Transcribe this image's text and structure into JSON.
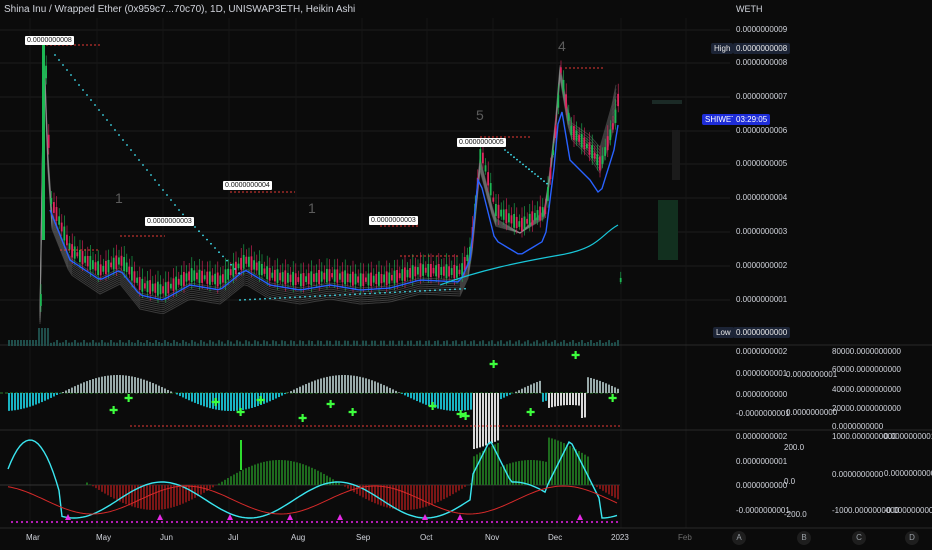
{
  "header": {
    "title": "Shina Inu / Wrapped Ether (0x959c7...70c70), 1D, UNISWAP3ETH, Heikin Ashi",
    "axis_unit": "WETH"
  },
  "price_axis": [
    "0.0000000009",
    "0.0000000008",
    "0.0000000007",
    "0.0000000006",
    "0.0000000005",
    "0.0000000004",
    "0.0000000003",
    "0.0000000002",
    "0.0000000001",
    "0.0000000000"
  ],
  "tags": {
    "high_label": "High",
    "high_value": "0.0000000008",
    "symbol_label": "SHIWETH",
    "countdown": "03:29:05",
    "low_label": "Low",
    "low_value": "0.0000000000"
  },
  "callouts": [
    "0.0000000008",
    "0.0000000003",
    "0.0000000004",
    "0.0000000003",
    "0.0000000005"
  ],
  "wave_labels": [
    "1",
    "1",
    "5",
    "4"
  ],
  "oscillator1": {
    "axis": [
      "0.0000000002",
      "0.0000000001",
      "0.0000000000",
      "-0.0000000001"
    ],
    "side_labels": [
      "0.0000000001",
      "0.0000000000"
    ],
    "far_axis": [
      "80000.0000000000",
      "60000.0000000000",
      "40000.0000000000",
      "20000.0000000000",
      "0.0000000000"
    ]
  },
  "oscillator2": {
    "axis": [
      "0.0000000002",
      "0.0000000001",
      "0.0000000000",
      "-0.0000000001"
    ],
    "side_axis": [
      "200.0",
      "0.0",
      "-200.0"
    ],
    "far_axis": [
      "1000.0000000000",
      "0.0000000000",
      "-1000.0000000000"
    ],
    "far_side": [
      "0.0000000001",
      "0.0000000000",
      "-0.0000000001"
    ]
  },
  "time_axis": [
    "Mar",
    "May",
    "Jun",
    "Jul",
    "Aug",
    "Sep",
    "Oct",
    "Nov",
    "Dec",
    "2023",
    "Feb"
  ],
  "corner_letters": [
    "A",
    "B",
    "C",
    "D"
  ],
  "colors": {
    "up": "#26a69a",
    "down": "#ef5350",
    "bull_candle": "#1db954",
    "bear_candle": "#e0245e",
    "ma_blue": "#2962ff",
    "ma_cyan": "#19c6d8",
    "dots": "#3fe0f0",
    "resist": "#e53935",
    "background": "#0b0b0b"
  }
}
